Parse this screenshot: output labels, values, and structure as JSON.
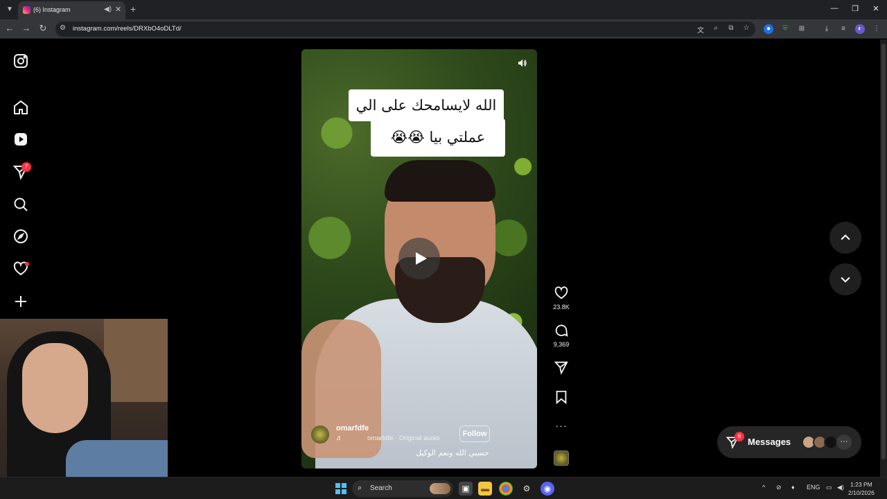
{
  "browser": {
    "tab_title": "(6) Instagram",
    "url": "instagram.com/reels/DRXbO4oDLTd/",
    "new_tab_symbol": "+",
    "tab_close_symbol": "✕"
  },
  "sidebar": {
    "messages_badge": "7"
  },
  "reel": {
    "caption_line1": "الله لايسامحك على الي",
    "caption_line2": "عملتي بيا 😭😭",
    "username": "omarfdfe",
    "audio": "omarfdfe · Original audio",
    "follow_label": "Follow",
    "description": "حسبي الله ونعم الوكيل"
  },
  "actions": {
    "likes": "23.8K",
    "comments": "9,369",
    "more": "···"
  },
  "messages": {
    "label": "Messages",
    "badge": "6",
    "more": "···"
  },
  "taskbar": {
    "search_placeholder": "Search",
    "language": "ENG",
    "time": "1:23 PM",
    "date": "2/10/2026"
  },
  "colors": {
    "notification_red": "#ff3040",
    "page_bg": "#000000",
    "panel_bg": "#262626"
  }
}
